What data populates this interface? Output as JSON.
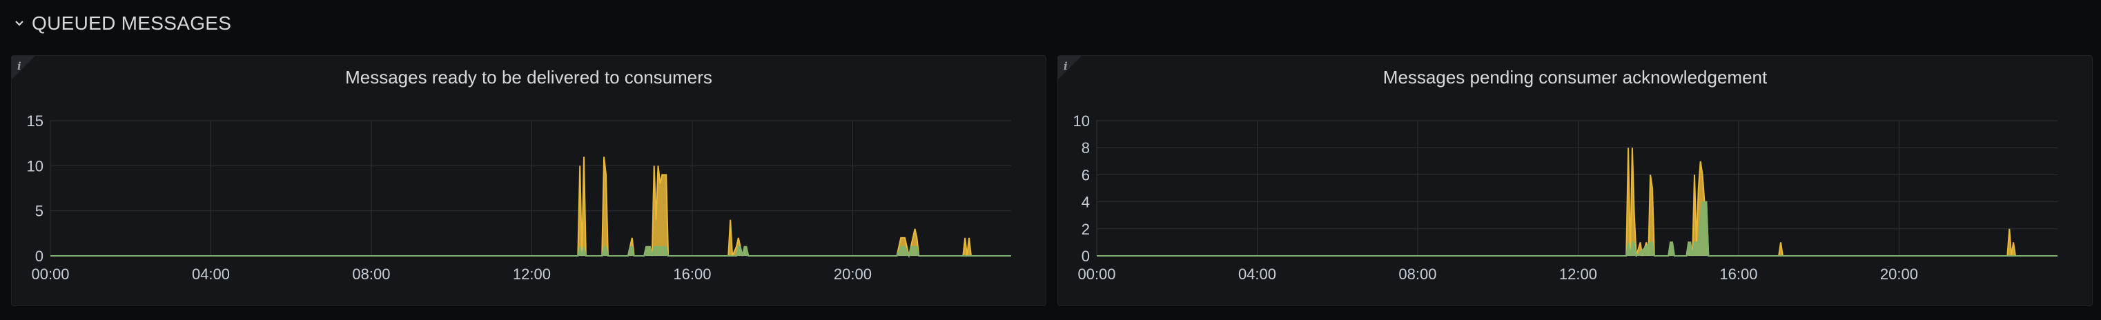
{
  "row": {
    "title": "QUEUED MESSAGES"
  },
  "panels": [
    {
      "title": "Messages ready to be delivered to consumers",
      "chart_data": {
        "type": "area",
        "xlabel": "",
        "ylabel": "",
        "x_ticks": [
          "00:00",
          "04:00",
          "08:00",
          "12:00",
          "16:00",
          "20:00"
        ],
        "x_range_hours": [
          0,
          23.95
        ],
        "y_ticks": [
          0,
          5,
          10,
          15
        ],
        "ylim": [
          0,
          15
        ],
        "grid": true,
        "series": [
          {
            "color": "#eab839",
            "points": [
              [
                0,
                0
              ],
              [
                13.15,
                0
              ],
              [
                13.2,
                10
              ],
              [
                13.25,
                0
              ],
              [
                13.3,
                11
              ],
              [
                13.35,
                0
              ],
              [
                13.75,
                0
              ],
              [
                13.8,
                11
              ],
              [
                13.85,
                9
              ],
              [
                13.9,
                0
              ],
              [
                14.4,
                0
              ],
              [
                14.45,
                1
              ],
              [
                14.5,
                2
              ],
              [
                14.55,
                0
              ],
              [
                14.8,
                0
              ],
              [
                14.85,
                1
              ],
              [
                14.95,
                1
              ],
              [
                15.0,
                0
              ],
              [
                15.05,
                10
              ],
              [
                15.1,
                4
              ],
              [
                15.15,
                10
              ],
              [
                15.2,
                8
              ],
              [
                15.25,
                9
              ],
              [
                15.3,
                9
              ],
              [
                15.35,
                9
              ],
              [
                15.4,
                0
              ],
              [
                16.9,
                0
              ],
              [
                16.95,
                4
              ],
              [
                17.0,
                0
              ],
              [
                17.1,
                1
              ],
              [
                17.15,
                2
              ],
              [
                17.2,
                1
              ],
              [
                17.25,
                0
              ],
              [
                17.3,
                1
              ],
              [
                17.35,
                1
              ],
              [
                17.4,
                0
              ],
              [
                21.1,
                0
              ],
              [
                21.2,
                2
              ],
              [
                21.3,
                2
              ],
              [
                21.4,
                0
              ],
              [
                21.45,
                1
              ],
              [
                21.55,
                3
              ],
              [
                21.6,
                2
              ],
              [
                21.65,
                0
              ],
              [
                22.75,
                0
              ],
              [
                22.8,
                2
              ],
              [
                22.85,
                0
              ],
              [
                22.9,
                2
              ],
              [
                22.95,
                0
              ],
              [
                23.95,
                0
              ]
            ]
          },
          {
            "color": "#7eb26d",
            "points": [
              [
                0,
                0
              ],
              [
                13.15,
                0
              ],
              [
                13.2,
                1
              ],
              [
                13.25,
                0
              ],
              [
                13.3,
                1
              ],
              [
                13.35,
                0
              ],
              [
                13.75,
                0
              ],
              [
                13.8,
                1
              ],
              [
                13.85,
                1
              ],
              [
                13.9,
                0
              ],
              [
                14.4,
                0
              ],
              [
                14.45,
                1
              ],
              [
                14.5,
                1
              ],
              [
                14.55,
                0
              ],
              [
                14.8,
                0
              ],
              [
                14.85,
                1
              ],
              [
                14.95,
                1
              ],
              [
                15.0,
                0
              ],
              [
                15.05,
                1
              ],
              [
                15.1,
                1
              ],
              [
                15.15,
                1
              ],
              [
                15.2,
                1
              ],
              [
                15.25,
                1
              ],
              [
                15.3,
                1
              ],
              [
                15.35,
                1
              ],
              [
                15.4,
                0
              ],
              [
                17.1,
                0
              ],
              [
                17.15,
                1
              ],
              [
                17.2,
                1
              ],
              [
                17.25,
                0
              ],
              [
                17.3,
                1
              ],
              [
                17.35,
                1
              ],
              [
                17.4,
                0
              ],
              [
                21.1,
                0
              ],
              [
                21.2,
                1
              ],
              [
                21.3,
                1
              ],
              [
                21.4,
                0
              ],
              [
                21.45,
                1
              ],
              [
                21.55,
                1
              ],
              [
                21.6,
                1
              ],
              [
                21.65,
                0
              ],
              [
                23.95,
                0
              ]
            ]
          }
        ]
      }
    },
    {
      "title": "Messages pending consumer acknowledgement",
      "chart_data": {
        "type": "area",
        "xlabel": "",
        "ylabel": "",
        "x_ticks": [
          "00:00",
          "04:00",
          "08:00",
          "12:00",
          "16:00",
          "20:00"
        ],
        "x_range_hours": [
          0,
          23.95
        ],
        "y_ticks": [
          0,
          2,
          4,
          6,
          8,
          10
        ],
        "ylim": [
          0,
          10
        ],
        "grid": true,
        "series": [
          {
            "color": "#eab839",
            "points": [
              [
                0,
                0
              ],
              [
                13.2,
                0
              ],
              [
                13.25,
                8
              ],
              [
                13.3,
                0
              ],
              [
                13.35,
                8
              ],
              [
                13.4,
                3
              ],
              [
                13.45,
                0
              ],
              [
                13.55,
                1
              ],
              [
                13.6,
                0
              ],
              [
                13.7,
                1
              ],
              [
                13.75,
                0
              ],
              [
                13.8,
                6
              ],
              [
                13.85,
                5
              ],
              [
                13.9,
                0
              ],
              [
                14.25,
                0
              ],
              [
                14.3,
                1
              ],
              [
                14.35,
                1
              ],
              [
                14.4,
                0
              ],
              [
                14.7,
                0
              ],
              [
                14.75,
                1
              ],
              [
                14.8,
                1
              ],
              [
                14.85,
                0
              ],
              [
                14.9,
                6
              ],
              [
                14.95,
                1
              ],
              [
                15.0,
                5
              ],
              [
                15.05,
                7
              ],
              [
                15.1,
                6
              ],
              [
                15.15,
                4
              ],
              [
                15.2,
                4
              ],
              [
                15.25,
                0
              ],
              [
                17.0,
                0
              ],
              [
                17.05,
                1
              ],
              [
                17.1,
                0
              ],
              [
                22.7,
                0
              ],
              [
                22.75,
                2
              ],
              [
                22.8,
                0
              ],
              [
                22.85,
                1
              ],
              [
                22.9,
                0
              ],
              [
                23.95,
                0
              ]
            ]
          },
          {
            "color": "#7eb26d",
            "points": [
              [
                0,
                0
              ],
              [
                13.2,
                0
              ],
              [
                13.25,
                1
              ],
              [
                13.3,
                0
              ],
              [
                13.35,
                1
              ],
              [
                13.4,
                1
              ],
              [
                13.45,
                0
              ],
              [
                13.8,
                1
              ],
              [
                13.85,
                1
              ],
              [
                13.9,
                0
              ],
              [
                14.25,
                0
              ],
              [
                14.3,
                1
              ],
              [
                14.35,
                1
              ],
              [
                14.4,
                0
              ],
              [
                14.7,
                0
              ],
              [
                14.75,
                1
              ],
              [
                14.8,
                1
              ],
              [
                14.85,
                0
              ],
              [
                14.9,
                1
              ],
              [
                14.95,
                1
              ],
              [
                15.0,
                1
              ],
              [
                15.05,
                3
              ],
              [
                15.1,
                4
              ],
              [
                15.15,
                4
              ],
              [
                15.2,
                4
              ],
              [
                15.25,
                0
              ],
              [
                23.95,
                0
              ]
            ]
          }
        ]
      }
    }
  ]
}
